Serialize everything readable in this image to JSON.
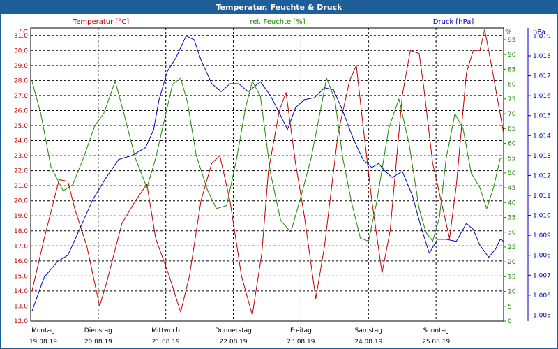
{
  "window": {
    "title": "Temperatur, Feuchte & Druck"
  },
  "colors": {
    "temperature": "#c00000",
    "humidity": "#1a8a00",
    "pressure": "#0000c0",
    "title_bar": "#1f5f99"
  },
  "chart_data": {
    "type": "line",
    "title": "Temperatur, Feuchte & Druck",
    "grid": true,
    "x_range": [
      0,
      7
    ],
    "axes": {
      "left": {
        "label": "Temperatur [°C]",
        "unit": "°C",
        "min": 12.0,
        "max": 31.5,
        "ticks": [
          "12.0",
          "13.0",
          "14.0",
          "15.0",
          "16.0",
          "17.0",
          "18.0",
          "19.0",
          "20.0",
          "21.0",
          "22.0",
          "23.0",
          "24.0",
          "25.0",
          "26.0",
          "27.0",
          "28.0",
          "29.0",
          "30.0",
          "31.0"
        ]
      },
      "mid": {
        "label": "rel. Feuchte [%]",
        "unit": "%",
        "min": 0,
        "max": 99,
        "ticks": [
          "0",
          "5",
          "10",
          "15",
          "20",
          "25",
          "30",
          "35",
          "40",
          "45",
          "50",
          "55",
          "60",
          "65",
          "70",
          "75",
          "80",
          "85",
          "90",
          "95"
        ]
      },
      "right": {
        "label": "Druck [hPa]",
        "unit": "hPa",
        "min": 1004.7,
        "max": 1019.4,
        "ticks": [
          "1.005",
          "1.006",
          "1.007",
          "1.008",
          "1.009",
          "1.010",
          "1.011",
          "1.012",
          "1.013",
          "1.014",
          "1.015",
          "1.016",
          "1.017",
          "1.018",
          "1.019"
        ]
      }
    },
    "days": [
      {
        "name": "Montag",
        "date": "19.08.19"
      },
      {
        "name": "Dienstag",
        "date": "20.08.19"
      },
      {
        "name": "Mittwoch",
        "date": "21.08.19"
      },
      {
        "name": "Donnerstag",
        "date": "22.08.19"
      },
      {
        "name": "Freitag",
        "date": "23.08.19"
      },
      {
        "name": "Samstag",
        "date": "24.08.19"
      },
      {
        "name": "Sonntag",
        "date": "25.08.19"
      }
    ],
    "series": [
      {
        "name": "Temperatur [°C]",
        "axis": "left",
        "color": "#c00000",
        "points": [
          [
            0.02,
            14.0
          ],
          [
            0.2,
            17.5
          ],
          [
            0.42,
            21.4
          ],
          [
            0.55,
            21.3
          ],
          [
            0.65,
            19.5
          ],
          [
            0.83,
            17.0
          ],
          [
            1.02,
            13.0
          ],
          [
            1.12,
            14.5
          ],
          [
            1.35,
            18.5
          ],
          [
            1.55,
            20.0
          ],
          [
            1.72,
            21.1
          ],
          [
            1.85,
            17.5
          ],
          [
            2.05,
            15.0
          ],
          [
            2.22,
            12.6
          ],
          [
            2.35,
            15.0
          ],
          [
            2.52,
            20.0
          ],
          [
            2.68,
            22.5
          ],
          [
            2.8,
            23.0
          ],
          [
            2.95,
            20.0
          ],
          [
            3.12,
            15.0
          ],
          [
            3.28,
            12.4
          ],
          [
            3.42,
            16.5
          ],
          [
            3.52,
            22.0
          ],
          [
            3.68,
            26.0
          ],
          [
            3.78,
            27.2
          ],
          [
            3.92,
            22.5
          ],
          [
            4.05,
            19.0
          ],
          [
            4.22,
            13.5
          ],
          [
            4.35,
            17.0
          ],
          [
            4.55,
            24.5
          ],
          [
            4.72,
            28.0
          ],
          [
            4.82,
            29.0
          ],
          [
            4.92,
            25.0
          ],
          [
            5.05,
            20.0
          ],
          [
            5.2,
            15.2
          ],
          [
            5.32,
            18.0
          ],
          [
            5.5,
            27.0
          ],
          [
            5.62,
            30.0
          ],
          [
            5.75,
            29.8
          ],
          [
            5.82,
            27.5
          ],
          [
            5.95,
            22.5
          ],
          [
            6.1,
            19.5
          ],
          [
            6.2,
            17.5
          ],
          [
            6.3,
            21.0
          ],
          [
            6.45,
            28.5
          ],
          [
            6.55,
            30.0
          ],
          [
            6.65,
            30.0
          ],
          [
            6.72,
            31.4
          ],
          [
            6.82,
            29.0
          ],
          [
            6.92,
            26.5
          ],
          [
            7.0,
            24.5
          ]
        ]
      },
      {
        "name": "rel. Feuchte [%]",
        "axis": "mid",
        "color": "#1a8a00",
        "points": [
          [
            0.02,
            81
          ],
          [
            0.15,
            70
          ],
          [
            0.3,
            52
          ],
          [
            0.48,
            44
          ],
          [
            0.62,
            46
          ],
          [
            0.78,
            55
          ],
          [
            0.95,
            66
          ],
          [
            1.08,
            70
          ],
          [
            1.25,
            81
          ],
          [
            1.38,
            70
          ],
          [
            1.55,
            55
          ],
          [
            1.72,
            45
          ],
          [
            1.85,
            55
          ],
          [
            2.0,
            70
          ],
          [
            2.1,
            80
          ],
          [
            2.22,
            82
          ],
          [
            2.32,
            74
          ],
          [
            2.45,
            56
          ],
          [
            2.62,
            44
          ],
          [
            2.75,
            38
          ],
          [
            2.9,
            39
          ],
          [
            3.05,
            55
          ],
          [
            3.18,
            72
          ],
          [
            3.28,
            81
          ],
          [
            3.4,
            76
          ],
          [
            3.55,
            50
          ],
          [
            3.7,
            34
          ],
          [
            3.85,
            30
          ],
          [
            4.0,
            42
          ],
          [
            4.15,
            55
          ],
          [
            4.28,
            70
          ],
          [
            4.38,
            82
          ],
          [
            4.5,
            75
          ],
          [
            4.62,
            55
          ],
          [
            4.75,
            40
          ],
          [
            4.88,
            28
          ],
          [
            5.0,
            27
          ],
          [
            5.12,
            40
          ],
          [
            5.3,
            65
          ],
          [
            5.45,
            75
          ],
          [
            5.6,
            60
          ],
          [
            5.75,
            38
          ],
          [
            5.85,
            30
          ],
          [
            5.95,
            27
          ],
          [
            6.05,
            35
          ],
          [
            6.15,
            55
          ],
          [
            6.28,
            70
          ],
          [
            6.4,
            65
          ],
          [
            6.52,
            50
          ],
          [
            6.65,
            45
          ],
          [
            6.75,
            38
          ],
          [
            6.85,
            45
          ],
          [
            6.95,
            55
          ],
          [
            7.0,
            55
          ]
        ]
      },
      {
        "name": "Druck [hPa]",
        "axis": "right",
        "color": "#0000c0",
        "points": [
          [
            0.02,
            1005.2
          ],
          [
            0.2,
            1006.9
          ],
          [
            0.4,
            1007.7
          ],
          [
            0.55,
            1008.0
          ],
          [
            0.75,
            1009.5
          ],
          [
            0.92,
            1010.8
          ],
          [
            1.1,
            1011.8
          ],
          [
            1.3,
            1012.8
          ],
          [
            1.5,
            1013.0
          ],
          [
            1.7,
            1013.4
          ],
          [
            1.82,
            1014.3
          ],
          [
            1.9,
            1015.8
          ],
          [
            2.02,
            1017.2
          ],
          [
            2.15,
            1017.9
          ],
          [
            2.3,
            1019.0
          ],
          [
            2.42,
            1018.8
          ],
          [
            2.52,
            1017.8
          ],
          [
            2.68,
            1016.6
          ],
          [
            2.82,
            1016.2
          ],
          [
            2.95,
            1016.6
          ],
          [
            3.08,
            1016.6
          ],
          [
            3.22,
            1016.2
          ],
          [
            3.4,
            1016.7
          ],
          [
            3.55,
            1016.0
          ],
          [
            3.7,
            1015.0
          ],
          [
            3.8,
            1014.3
          ],
          [
            3.92,
            1015.4
          ],
          [
            4.05,
            1015.8
          ],
          [
            4.2,
            1015.9
          ],
          [
            4.35,
            1016.4
          ],
          [
            4.48,
            1016.3
          ],
          [
            4.6,
            1015.4
          ],
          [
            4.78,
            1013.8
          ],
          [
            4.92,
            1012.8
          ],
          [
            5.05,
            1012.4
          ],
          [
            5.15,
            1012.6
          ],
          [
            5.25,
            1012.2
          ],
          [
            5.35,
            1011.9
          ],
          [
            5.5,
            1012.2
          ],
          [
            5.65,
            1011.0
          ],
          [
            5.78,
            1009.4
          ],
          [
            5.9,
            1008.1
          ],
          [
            6.02,
            1008.8
          ],
          [
            6.15,
            1008.8
          ],
          [
            6.3,
            1008.7
          ],
          [
            6.45,
            1009.6
          ],
          [
            6.55,
            1009.3
          ],
          [
            6.65,
            1008.5
          ],
          [
            6.78,
            1007.9
          ],
          [
            6.88,
            1008.3
          ],
          [
            6.95,
            1008.8
          ],
          [
            7.0,
            1008.7
          ]
        ]
      }
    ]
  }
}
